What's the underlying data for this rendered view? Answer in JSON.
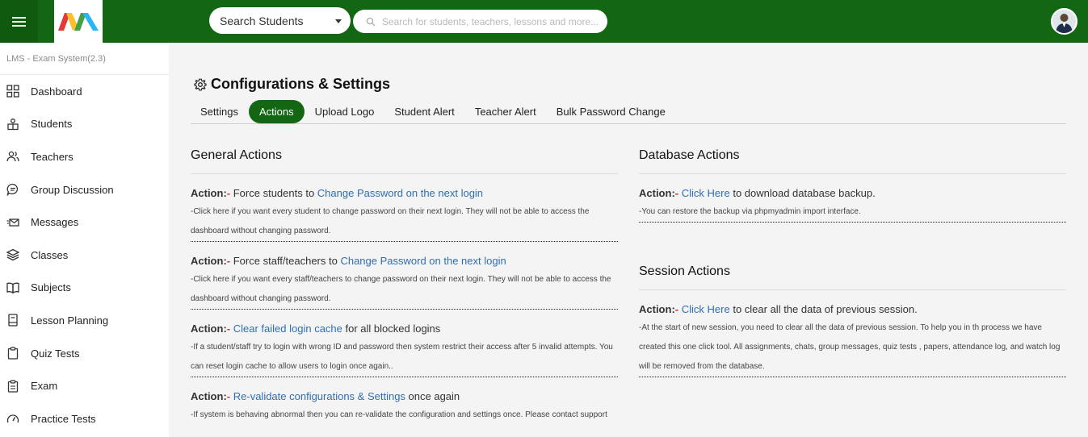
{
  "header": {
    "search_select_value": "Search Students",
    "search_placeholder": "Search for students, teachers, lessons and more..."
  },
  "sidebar": {
    "system_name": "LMS - Exam System(2.3)",
    "items": [
      {
        "label": "Dashboard",
        "icon": "grid-icon"
      },
      {
        "label": "Students",
        "icon": "student-icon"
      },
      {
        "label": "Teachers",
        "icon": "users-icon"
      },
      {
        "label": "Group Discussion",
        "icon": "chat-icon"
      },
      {
        "label": "Messages",
        "icon": "mail-icon"
      },
      {
        "label": "Classes",
        "icon": "layers-icon"
      },
      {
        "label": "Subjects",
        "icon": "book-icon"
      },
      {
        "label": "Lesson Planning",
        "icon": "notebook-icon"
      },
      {
        "label": "Quiz Tests",
        "icon": "clipboard-icon"
      },
      {
        "label": "Exam",
        "icon": "exam-icon"
      },
      {
        "label": "Practice Tests",
        "icon": "gauge-icon"
      }
    ]
  },
  "page": {
    "title": "Configurations & Settings",
    "tabs": [
      "Settings",
      "Actions",
      "Upload Logo",
      "Student Alert",
      "Teacher Alert",
      "Bulk Password Change"
    ],
    "active_tab": "Actions"
  },
  "general_actions": {
    "title": "General Actions",
    "items": [
      {
        "prefix": "Action:",
        "dash": "-",
        "before": " Force students to ",
        "link": "Change Password on the next login",
        "after": "",
        "desc": "-Click here if you want every student to change password on their next login. They will not be able to access the dashboard without changing password."
      },
      {
        "prefix": "Action:",
        "dash": "-",
        "before": " Force staff/teachers to ",
        "link": "Change Password on the next login",
        "after": "",
        "desc": "-Click here if you want every staff/teachers to change password on their next login. They will not be able to access the dashboard without changing password."
      },
      {
        "prefix": "Action:",
        "dash": "-",
        "before": " ",
        "link": "Clear failed login cache",
        "after": " for all blocked logins",
        "desc": "-If a student/staff try to login with wrong ID and password then system restrict their access after 5 invalid attempts. You can reset login cache to allow users to login once again.."
      },
      {
        "prefix": "Action:",
        "dash": "-",
        "before": " ",
        "link": "Re-validate configurations & Settings",
        "after": " once again",
        "desc": "-If system is behaving abnormal then you can re-validate the configuration and settings once. Please contact support"
      }
    ]
  },
  "database_actions": {
    "title": "Database Actions",
    "items": [
      {
        "prefix": "Action:",
        "dash": "-",
        "before": " ",
        "link": "Click Here",
        "after": " to download database backup.",
        "desc": "-You can restore the backup via phpmyadmin import interface."
      }
    ]
  },
  "session_actions": {
    "title": "Session Actions",
    "items": [
      {
        "prefix": "Action:",
        "dash": "-",
        "before": " ",
        "link": "Click Here",
        "after": " to clear all the data of previous session.",
        "desc": "-At the start of new session, you need to clear all the data of previous session. To help you in th process we have created this one click tool. All assignments, chats, group messages, quiz tests , papers, attendance log, and watch log will be removed from the database."
      }
    ]
  },
  "colors": {
    "brand_green": "#136612",
    "link_blue": "#2f6fb3",
    "dash_red": "#c0392b"
  }
}
